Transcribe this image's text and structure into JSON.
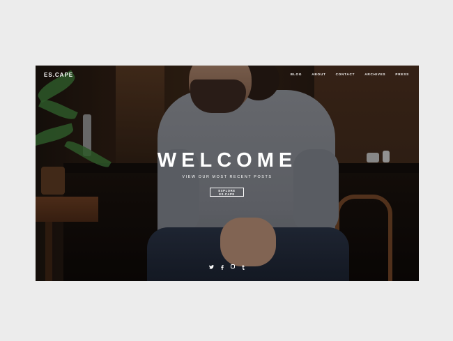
{
  "site": {
    "logo": "ES.CAPE"
  },
  "nav": {
    "items": [
      {
        "label": "BLOG"
      },
      {
        "label": "ABOUT"
      },
      {
        "label": "CONTACT"
      },
      {
        "label": "ARCHIVES"
      },
      {
        "label": "PRESS"
      }
    ]
  },
  "hero": {
    "title": "WELCOME",
    "subtitle": "VIEW OUR MOST RECENT POSTS",
    "button_label": "EXPLORE ES.CAPE"
  },
  "social": {
    "icons": [
      "twitter-icon",
      "facebook-icon",
      "instagram-icon",
      "tumblr-icon"
    ],
    "glyphs": [
      "🐦",
      "f",
      "",
      "t"
    ]
  },
  "colors": {
    "page_background": "#ececec",
    "text": "#ffffff"
  }
}
